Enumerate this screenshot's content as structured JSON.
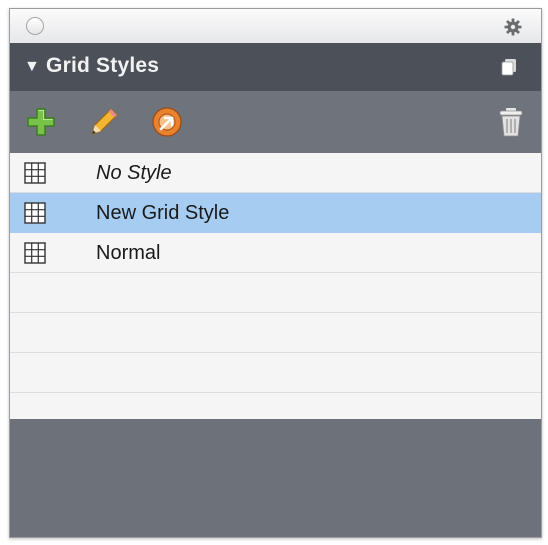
{
  "panel": {
    "title": "Grid Styles",
    "title_arrow": "▼"
  },
  "toolbar": {
    "buttons": [
      {
        "name": "add-icon",
        "color": "#6ab04c"
      },
      {
        "name": "pencil-icon",
        "color": "#f0b030"
      },
      {
        "name": "duplicate-style-icon",
        "color": "#e87a2a"
      },
      {
        "name": "trash-icon",
        "color": "#d8d8d8"
      }
    ]
  },
  "styles": [
    {
      "label": "No Style",
      "italic": true,
      "selected": false
    },
    {
      "label": "New Grid Style",
      "italic": false,
      "selected": true
    },
    {
      "label": "Normal",
      "italic": false,
      "selected": false
    }
  ],
  "colors": {
    "header_bg": "#4c5159",
    "toolbar_bg": "#6e737c",
    "selection": "#a6cdf1"
  }
}
